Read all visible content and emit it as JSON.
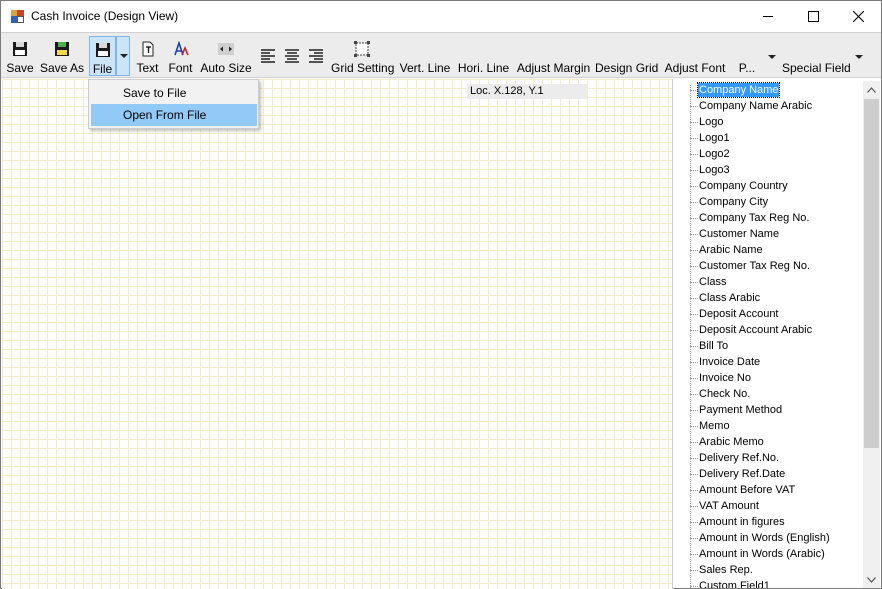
{
  "window": {
    "title": "Cash Invoice (Design View)"
  },
  "toolbar": {
    "buttons": [
      {
        "label": "Save",
        "icon": "floppy-disk-icon"
      },
      {
        "label": "Save As",
        "icon": "floppy-save-as-icon"
      },
      {
        "label": "File",
        "icon": "floppy-file-icon"
      },
      {
        "label": "Text",
        "icon": "text-box-icon"
      },
      {
        "label": "Font",
        "icon": "font-icon"
      },
      {
        "label": "Auto Size",
        "icon": "auto-size-icon"
      },
      {
        "label": "",
        "icon": "align-left-icon"
      },
      {
        "label": "",
        "icon": "align-center-icon"
      },
      {
        "label": "",
        "icon": "align-right-icon"
      },
      {
        "label": "Grid Setting",
        "icon": "grid-setting-icon"
      },
      {
        "label": "Vert. Line",
        "icon": ""
      },
      {
        "label": "Hori. Line",
        "icon": ""
      },
      {
        "label": "Adjust Margin",
        "icon": ""
      },
      {
        "label": "Design Grid",
        "icon": ""
      },
      {
        "label": "Adjust Font",
        "icon": ""
      },
      {
        "label": "P...",
        "icon": ""
      },
      {
        "label": "Special Field",
        "icon": ""
      }
    ]
  },
  "file_menu": {
    "items": [
      "Save to File",
      "Open From File"
    ],
    "highlighted": "Open From File"
  },
  "canvas": {
    "location_readout": "Loc. X.128, Y.1"
  },
  "fields": {
    "selected": "Company Name",
    "items": [
      "Company Name",
      "Company Name Arabic",
      "Logo",
      "Logo1",
      "Logo2",
      "Logo3",
      "Company Country",
      "Company City",
      "Company Tax Reg No.",
      "Customer Name",
      "Arabic Name",
      "Customer Tax Reg No.",
      "Class",
      "Class Arabic",
      "Deposit Account",
      "Deposit Account Arabic",
      "Bill To",
      "Invoice Date",
      "Invoice No",
      "Check No.",
      "Payment Method",
      "Memo",
      "Arabic Memo",
      "Delivery Ref.No.",
      "Delivery Ref.Date",
      "Amount Before VAT",
      "VAT Amount",
      "Amount in figures",
      "Amount in Words (English)",
      "Amount in Words (Arabic)",
      "Sales Rep.",
      "Custom Field1"
    ]
  },
  "colors": {
    "toolbar_bg": "#ececec",
    "active_button_bg": "#cce4f7",
    "menu_highlight": "#91c9f7",
    "selection": "#3399ff",
    "grid_line": "#f2ecc9"
  }
}
